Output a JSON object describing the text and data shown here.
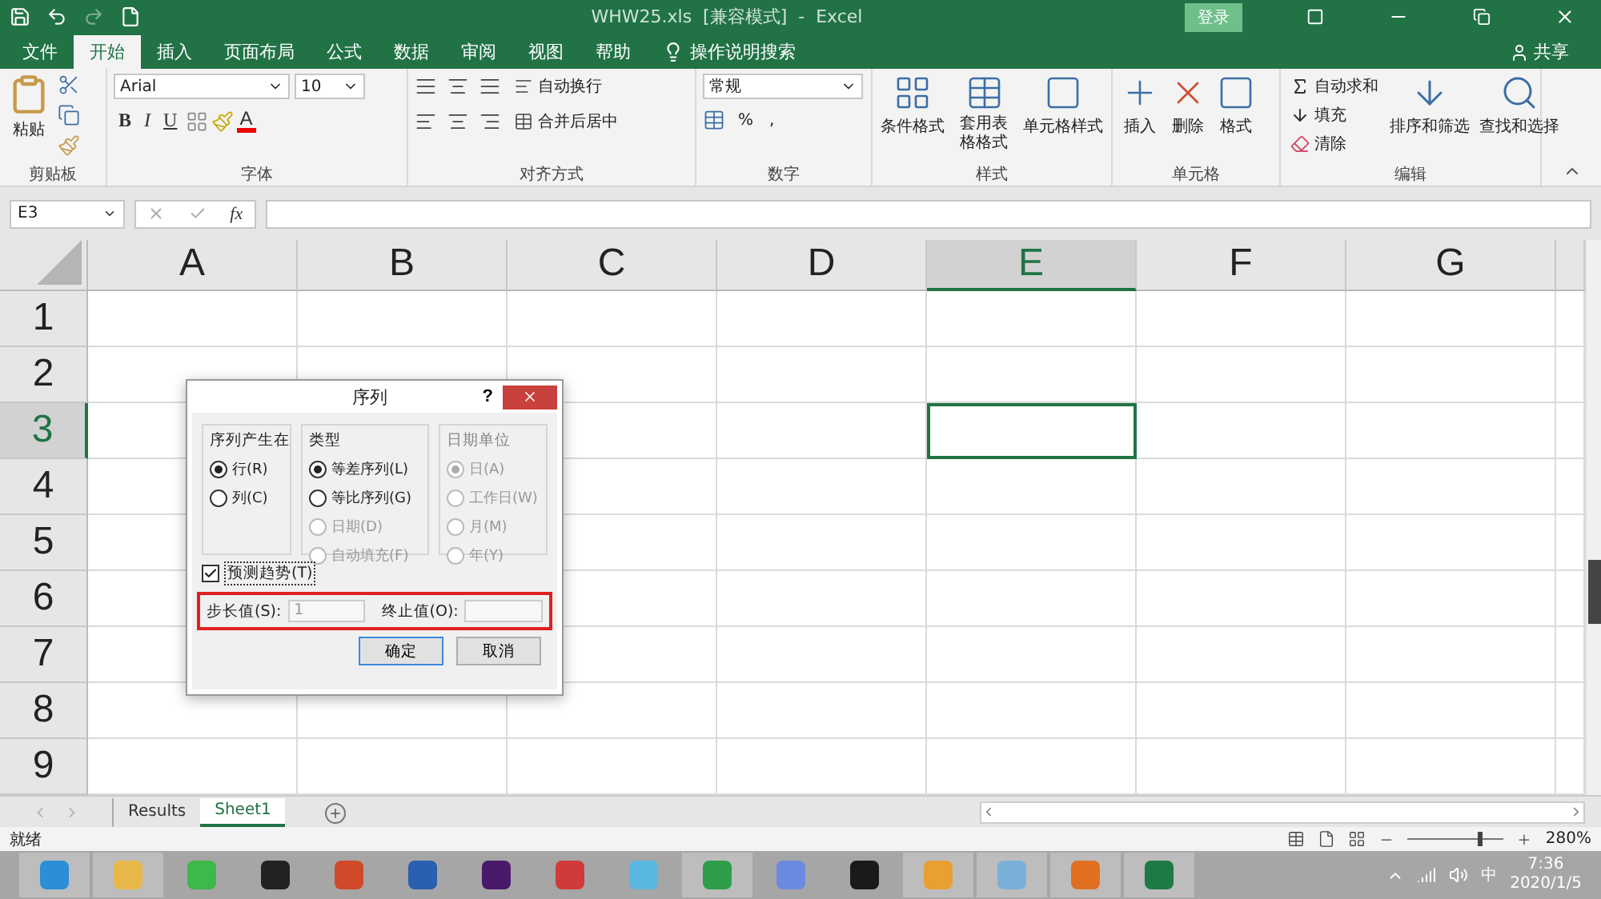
{
  "window": {
    "title": "WHW25.xls  [兼容模式]  -  Excel",
    "login": "登录"
  },
  "menu_tabs": [
    {
      "label": "文件",
      "selected": false
    },
    {
      "label": "开始",
      "selected": true
    },
    {
      "label": "插入",
      "selected": false
    },
    {
      "label": "页面布局",
      "selected": false
    },
    {
      "label": "公式",
      "selected": false
    },
    {
      "label": "数据",
      "selected": false
    },
    {
      "label": "审阅",
      "selected": false
    },
    {
      "label": "视图",
      "selected": false
    },
    {
      "label": "帮助",
      "selected": false
    }
  ],
  "tell_me": "操作说明搜索",
  "share": "共享",
  "ribbon": {
    "clipboard": {
      "label": "剪贴板",
      "paste": "粘贴"
    },
    "font": {
      "label": "字体",
      "font_name": "Arial",
      "font_size": "10",
      "bold": "B",
      "italic": "I",
      "underline": "U",
      "font_color": "A"
    },
    "alignment": {
      "label": "对齐方式",
      "wrap": "自动换行",
      "merge": "合并后居中"
    },
    "number": {
      "label": "数字",
      "format": "常规",
      "percent": "%",
      "comma": ","
    },
    "styles": {
      "label": "样式",
      "buttons": [
        "条件格式",
        "套用表格格式",
        "单元格样式"
      ]
    },
    "cells": {
      "label": "单元格",
      "buttons": [
        "插入",
        "删除",
        "格式"
      ]
    },
    "editing": {
      "label": "编辑",
      "small": [
        "自动求和",
        "填充",
        "清除"
      ],
      "big": [
        "排序和筛选",
        "查找和选择"
      ]
    }
  },
  "formula_bar": {
    "name_box": "E3",
    "fx": "fx"
  },
  "sheet": {
    "columns": [
      {
        "label": "A",
        "selected": false
      },
      {
        "label": "B",
        "selected": false
      },
      {
        "label": "C",
        "selected": false
      },
      {
        "label": "D",
        "selected": false
      },
      {
        "label": "E",
        "selected": true
      },
      {
        "label": "F",
        "selected": false
      },
      {
        "label": "G",
        "selected": false
      }
    ],
    "rows": [
      {
        "label": "1",
        "selected": false
      },
      {
        "label": "2",
        "selected": false
      },
      {
        "label": "3",
        "selected": true
      },
      {
        "label": "4",
        "selected": false
      },
      {
        "label": "5",
        "selected": false
      },
      {
        "label": "6",
        "selected": false
      },
      {
        "label": "7",
        "selected": false
      },
      {
        "label": "8",
        "selected": false
      },
      {
        "label": "9",
        "selected": false
      }
    ]
  },
  "dialog": {
    "title": "序列",
    "help": "?",
    "groups": [
      {
        "label": "序列产生在",
        "options": [
          {
            "label": "行(R)",
            "selected": true,
            "disabled": false
          },
          {
            "label": "列(C)",
            "selected": false,
            "disabled": false
          }
        ]
      },
      {
        "label": "类型",
        "options": [
          {
            "label": "等差序列(L)",
            "selected": true,
            "disabled": false
          },
          {
            "label": "等比序列(G)",
            "selected": false,
            "disabled": false
          },
          {
            "label": "日期(D)",
            "selected": false,
            "disabled": true
          },
          {
            "label": "自动填充(F)",
            "selected": false,
            "disabled": true
          }
        ]
      },
      {
        "label": "日期单位",
        "disabled": true,
        "options": [
          {
            "label": "日(A)",
            "selected": true,
            "disabled": true
          },
          {
            "label": "工作日(W)",
            "selected": false,
            "disabled": true
          },
          {
            "label": "月(M)",
            "selected": false,
            "disabled": true
          },
          {
            "label": "年(Y)",
            "selected": false,
            "disabled": true
          }
        ]
      }
    ],
    "trend": {
      "label": "预测趋势(T)",
      "checked": true
    },
    "step": {
      "label": "步长值(S):",
      "value": "1"
    },
    "stop": {
      "label": "终止值(O):"
    },
    "highlighted": true,
    "buttons": [
      {
        "label": "确定",
        "default": true
      },
      {
        "label": "取消",
        "default": false
      }
    ]
  },
  "sheet_tabs": [
    {
      "label": "Results",
      "selected": false
    },
    {
      "label": "Sheet1",
      "selected": true
    }
  ],
  "status": {
    "text": "就绪",
    "zoom": "280%",
    "level": 0.75
  },
  "taskbar": {
    "apps": [
      {
        "color": "#2b8fd8",
        "open": true
      },
      {
        "color": "#e8b84a",
        "open": true
      },
      {
        "color": "#3cb94a",
        "open": false
      },
      {
        "color": "#222222",
        "open": false
      },
      {
        "color": "#d04a2a",
        "open": false
      },
      {
        "color": "#2b5fb0",
        "open": false
      },
      {
        "color": "#4a1a6a",
        "open": false
      },
      {
        "color": "#d03a3a",
        "open": false
      },
      {
        "color": "#5ab8e0",
        "open": false
      },
      {
        "color": "#2e9e4a",
        "open": true
      },
      {
        "color": "#6a8ae0",
        "open": false
      },
      {
        "color": "#1a1a1a",
        "open": false
      },
      {
        "color": "#e8a030",
        "open": true
      },
      {
        "color": "#7ab0d8",
        "open": true
      },
      {
        "color": "#e07020",
        "open": true
      },
      {
        "color": "#1e7a45",
        "open": true
      }
    ],
    "ime": "中",
    "time": "7:36",
    "date": "2020/1/5"
  }
}
